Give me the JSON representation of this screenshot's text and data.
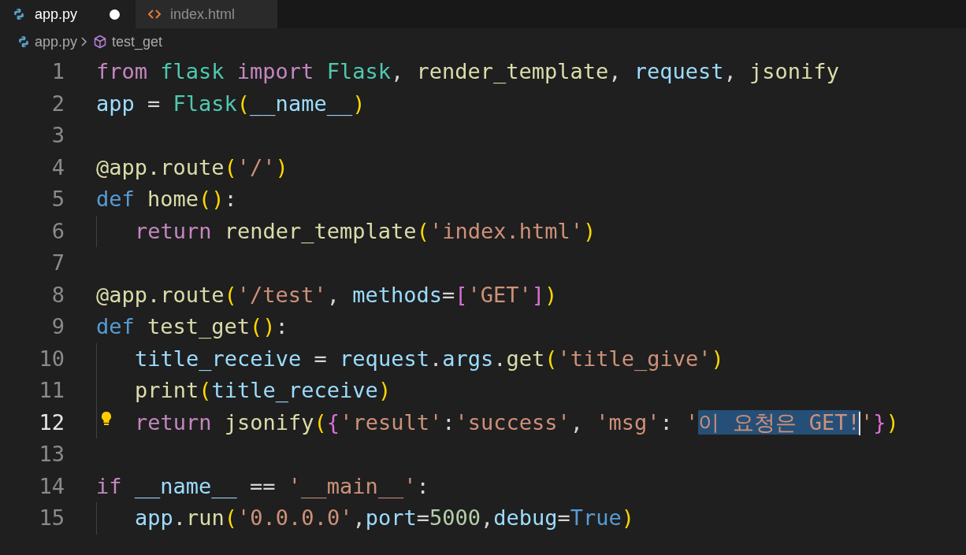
{
  "tabs": [
    {
      "label": "app.py",
      "kind": "python",
      "selected": true,
      "modified": true
    },
    {
      "label": "index.html",
      "kind": "html",
      "selected": false,
      "modified": false
    }
  ],
  "breadcrumbs": [
    {
      "label": "app.py",
      "kind": "python"
    },
    {
      "label": "test_get",
      "kind": "symbol"
    }
  ],
  "lines": [
    {
      "number": "1",
      "active": false,
      "indented": false,
      "lightbulb": false,
      "tokens": [
        {
          "text": "from ",
          "kind": "keyword"
        },
        {
          "text": "flask ",
          "kind": "class"
        },
        {
          "text": "import ",
          "kind": "keyword"
        },
        {
          "text": "Flask",
          "kind": "class"
        },
        {
          "text": ", "
        },
        {
          "text": "render_template",
          "kind": "function"
        },
        {
          "text": ", "
        },
        {
          "text": "request",
          "kind": "variable"
        },
        {
          "text": ", "
        },
        {
          "text": "jsonify",
          "kind": "function"
        }
      ]
    },
    {
      "number": "2",
      "active": false,
      "indented": false,
      "lightbulb": false,
      "tokens": [
        {
          "text": "app",
          "kind": "variable"
        },
        {
          "text": " = "
        },
        {
          "text": "Flask",
          "kind": "class"
        },
        {
          "text": "(",
          "kind": "bracket1"
        },
        {
          "text": "__name__",
          "kind": "variable"
        },
        {
          "text": ")",
          "kind": "bracket1"
        }
      ]
    },
    {
      "number": "3",
      "active": false,
      "indented": false,
      "lightbulb": false
    },
    {
      "number": "4",
      "active": false,
      "indented": false,
      "lightbulb": false,
      "tokens": [
        {
          "text": "@app.route",
          "kind": "function"
        },
        {
          "text": "(",
          "kind": "bracket1"
        },
        {
          "text": "'/'",
          "kind": "string"
        },
        {
          "text": ")",
          "kind": "bracket1"
        }
      ]
    },
    {
      "number": "5",
      "active": false,
      "indented": false,
      "lightbulb": false,
      "tokens": [
        {
          "text": "def ",
          "kind": "storage"
        },
        {
          "text": "home",
          "kind": "function"
        },
        {
          "text": "()",
          "kind": "bracket1"
        },
        {
          "text": ":"
        }
      ]
    },
    {
      "number": "6",
      "active": false,
      "indented": true,
      "lightbulb": false,
      "tokens": [
        {
          "text": "return ",
          "kind": "keyword"
        },
        {
          "text": "render_template",
          "kind": "function"
        },
        {
          "text": "(",
          "kind": "bracket1"
        },
        {
          "text": "'index.html'",
          "kind": "string"
        },
        {
          "text": ")",
          "kind": "bracket1"
        }
      ]
    },
    {
      "number": "7",
      "active": false,
      "indented": false,
      "lightbulb": false
    },
    {
      "number": "8",
      "active": false,
      "indented": false,
      "lightbulb": false,
      "tokens": [
        {
          "text": "@app.route",
          "kind": "function"
        },
        {
          "text": "(",
          "kind": "bracket1"
        },
        {
          "text": "'/test'",
          "kind": "string"
        },
        {
          "text": ", "
        },
        {
          "text": "methods",
          "kind": "variable"
        },
        {
          "text": "="
        },
        {
          "text": "[",
          "kind": "bracket2"
        },
        {
          "text": "'GET'",
          "kind": "string"
        },
        {
          "text": "]",
          "kind": "bracket2"
        },
        {
          "text": ")",
          "kind": "bracket1"
        }
      ]
    },
    {
      "number": "9",
      "active": false,
      "indented": false,
      "lightbulb": false,
      "tokens": [
        {
          "text": "def ",
          "kind": "storage"
        },
        {
          "text": "test_get",
          "kind": "function"
        },
        {
          "text": "()",
          "kind": "bracket1"
        },
        {
          "text": ":"
        }
      ]
    },
    {
      "number": "10",
      "active": false,
      "indented": true,
      "lightbulb": false,
      "tokens": [
        {
          "text": "title_receive",
          "kind": "variable"
        },
        {
          "text": " = "
        },
        {
          "text": "request",
          "kind": "variable"
        },
        {
          "text": "."
        },
        {
          "text": "args",
          "kind": "variable"
        },
        {
          "text": "."
        },
        {
          "text": "get",
          "kind": "function"
        },
        {
          "text": "(",
          "kind": "bracket1"
        },
        {
          "text": "'title_give'",
          "kind": "string"
        },
        {
          "text": ")",
          "kind": "bracket1"
        }
      ]
    },
    {
      "number": "11",
      "active": false,
      "indented": true,
      "lightbulb": false,
      "tokens": [
        {
          "text": "print",
          "kind": "function"
        },
        {
          "text": "(",
          "kind": "bracket1"
        },
        {
          "text": "title_receive",
          "kind": "variable"
        },
        {
          "text": ")",
          "kind": "bracket1"
        }
      ]
    },
    {
      "number": "12",
      "active": true,
      "indented": true,
      "lightbulb": true,
      "tokens": [
        {
          "text": "return ",
          "kind": "keyword"
        },
        {
          "text": "jsonify",
          "kind": "function"
        },
        {
          "text": "(",
          "kind": "bracket1"
        },
        {
          "text": "{",
          "kind": "bracket2"
        },
        {
          "text": "'result'",
          "kind": "string"
        },
        {
          "text": ":"
        },
        {
          "text": "'success'",
          "kind": "string"
        },
        {
          "text": ", "
        },
        {
          "text": "'msg'",
          "kind": "string"
        },
        {
          "text": ": "
        },
        {
          "text": "'",
          "kind": "string"
        },
        {
          "text": "이 요청은 GET!",
          "kind": "string",
          "selected": true,
          "cursor": true
        },
        {
          "text": "'",
          "kind": "string"
        },
        {
          "text": "}",
          "kind": "bracket2"
        },
        {
          "text": ")",
          "kind": "bracket1"
        }
      ]
    },
    {
      "number": "13",
      "active": false,
      "indented": false,
      "lightbulb": false
    },
    {
      "number": "14",
      "active": false,
      "indented": false,
      "lightbulb": false,
      "tokens": [
        {
          "text": "if ",
          "kind": "keyword"
        },
        {
          "text": "__name__",
          "kind": "variable"
        },
        {
          "text": " == "
        },
        {
          "text": "'__main__'",
          "kind": "string"
        },
        {
          "text": ":"
        }
      ]
    },
    {
      "number": "15",
      "active": false,
      "indented": true,
      "lightbulb": false,
      "tokens": [
        {
          "text": "app",
          "kind": "variable"
        },
        {
          "text": "."
        },
        {
          "text": "run",
          "kind": "function"
        },
        {
          "text": "(",
          "kind": "bracket1"
        },
        {
          "text": "'0.0.0.0'",
          "kind": "string"
        },
        {
          "text": ","
        },
        {
          "text": "port",
          "kind": "variable"
        },
        {
          "text": "="
        },
        {
          "text": "5000",
          "kind": "number"
        },
        {
          "text": ","
        },
        {
          "text": "debug",
          "kind": "variable"
        },
        {
          "text": "="
        },
        {
          "text": "True",
          "kind": "storage"
        },
        {
          "text": ")",
          "kind": "bracket1"
        }
      ]
    }
  ]
}
